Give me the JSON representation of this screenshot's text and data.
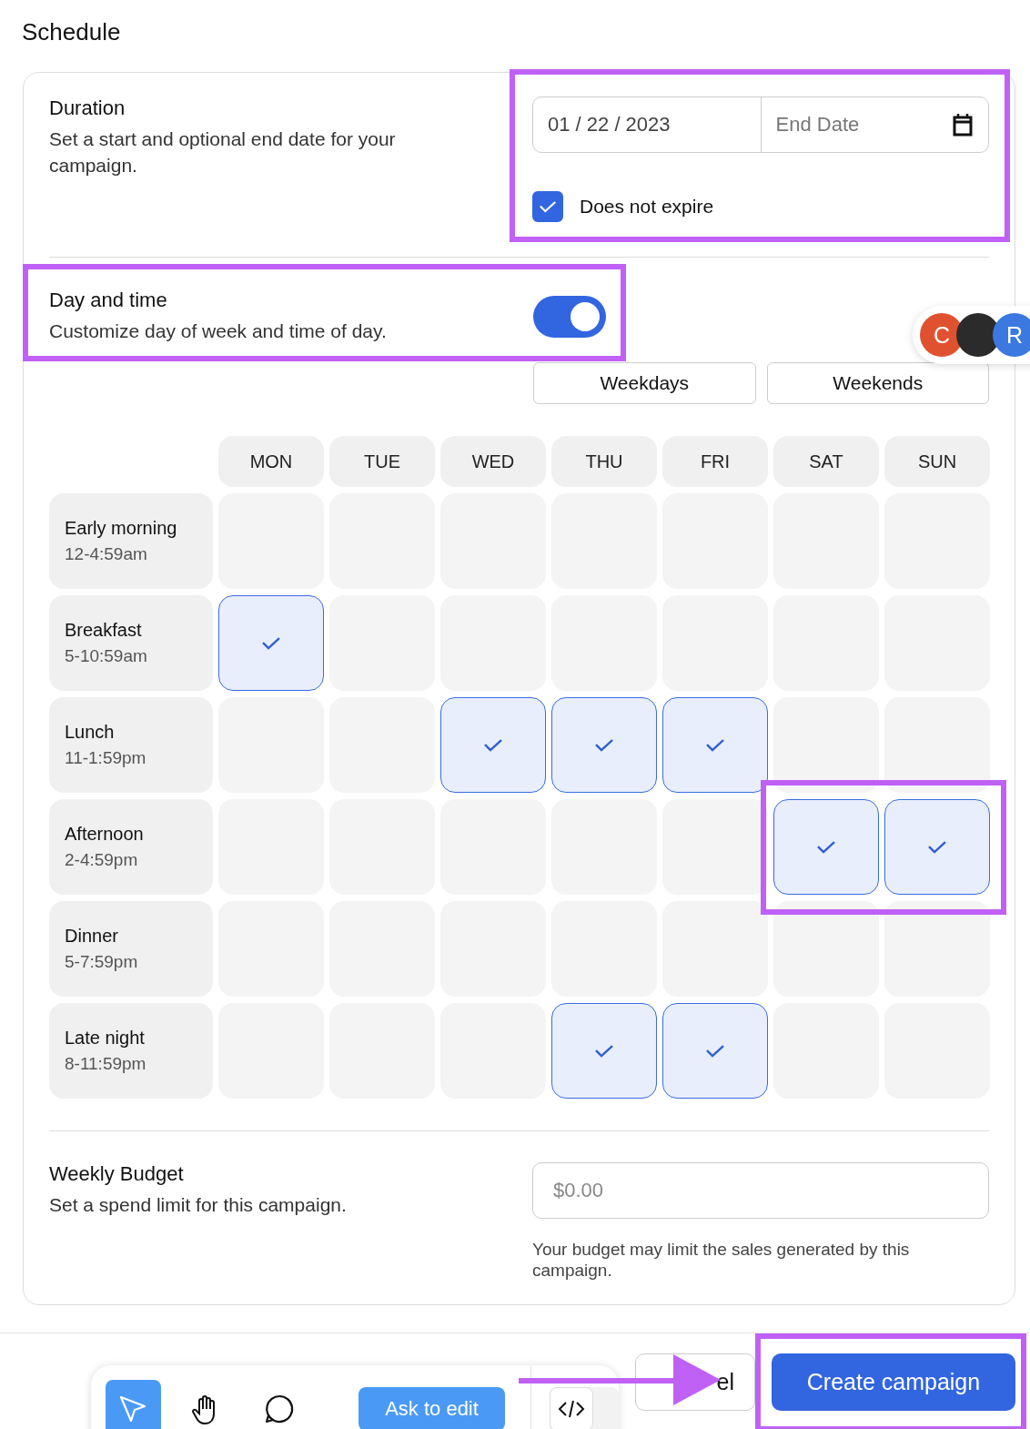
{
  "title": "Schedule",
  "duration": {
    "heading": "Duration",
    "description": "Set a start and optional end date for your campaign.",
    "start_date": "01 / 22 / 2023",
    "end_date_placeholder": "End Date",
    "does_not_expire": {
      "label": "Does not expire",
      "checked": true
    }
  },
  "day_and_time": {
    "heading": "Day and time",
    "description": "Customize day of week and time of day.",
    "on": true,
    "presets": [
      "Weekdays",
      "Weekends"
    ]
  },
  "avatars": [
    {
      "initial": "C",
      "color": "#e0522f"
    },
    {
      "color": "#2b2b2b"
    },
    {
      "initial": "R",
      "color": "#3b78e0"
    }
  ],
  "days": [
    "MON",
    "TUE",
    "WED",
    "THU",
    "FRI",
    "SAT",
    "SUN"
  ],
  "slots": [
    {
      "name": "Early morning",
      "time": "12-4:59am",
      "cells": [
        {
          "selected": false
        },
        {
          "selected": false
        },
        {
          "selected": false
        },
        {
          "selected": false
        },
        {
          "selected": false
        },
        {
          "selected": false
        },
        {
          "selected": false
        }
      ]
    },
    {
      "name": "Breakfast",
      "time": "5-10:59am",
      "cells": [
        {
          "selected": true
        },
        {
          "selected": false
        },
        {
          "selected": false
        },
        {
          "selected": false
        },
        {
          "selected": false
        },
        {
          "selected": false
        },
        {
          "selected": false
        }
      ]
    },
    {
      "name": "Lunch",
      "time": "11-1:59pm",
      "cells": [
        {
          "selected": false
        },
        {
          "selected": false
        },
        {
          "selected": true
        },
        {
          "selected": true
        },
        {
          "selected": true
        },
        {
          "selected": false
        },
        {
          "selected": false
        }
      ]
    },
    {
      "name": "Afternoon",
      "time": "2-4:59pm",
      "cells": [
        {
          "selected": false
        },
        {
          "selected": false
        },
        {
          "selected": false
        },
        {
          "selected": false
        },
        {
          "selected": false
        },
        {
          "selected": true
        },
        {
          "selected": true
        }
      ]
    },
    {
      "name": "Dinner",
      "time": "5-7:59pm",
      "cells": [
        {
          "selected": false
        },
        {
          "selected": false
        },
        {
          "selected": false
        },
        {
          "selected": false
        },
        {
          "selected": false
        },
        {
          "selected": false
        },
        {
          "selected": false
        }
      ]
    },
    {
      "name": "Late night",
      "time": "8-11:59pm",
      "cells": [
        {
          "selected": false
        },
        {
          "selected": false
        },
        {
          "selected": false
        },
        {
          "selected": true
        },
        {
          "selected": true
        },
        {
          "selected": false
        },
        {
          "selected": false
        }
      ]
    }
  ],
  "budget": {
    "heading": "Weekly Budget",
    "description": "Set a spend limit for this campaign.",
    "placeholder": "$0.00",
    "help": "Your budget may limit the sales generated by this campaign."
  },
  "footer": {
    "cancel_label": "el",
    "create_label": "Create campaign",
    "create_highlighted": true
  },
  "toolbar": {
    "tools": [
      {
        "kind": "pointer",
        "selected": true
      },
      {
        "kind": "hand",
        "selected": false
      },
      {
        "kind": "comment",
        "selected": false
      }
    ],
    "ask_label": "Ask to edit"
  },
  "highlights": [
    {
      "kind": "frame"
    },
    {
      "kind": "frame"
    },
    {
      "kind": "frame"
    },
    {
      "kind": "arrow"
    }
  ]
}
